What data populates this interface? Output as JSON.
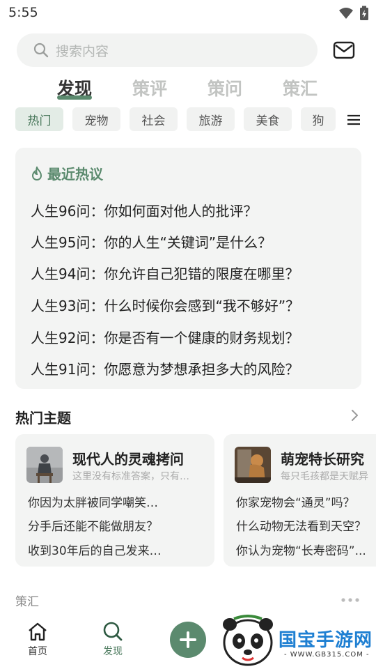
{
  "status_bar": {
    "time": "5:55"
  },
  "search": {
    "placeholder": "搜索内容"
  },
  "tabs": [
    {
      "label": "发现",
      "active": true
    },
    {
      "label": "策评",
      "active": false
    },
    {
      "label": "策问",
      "active": false
    },
    {
      "label": "策汇",
      "active": false
    }
  ],
  "chips": [
    {
      "label": "热门",
      "active": true
    },
    {
      "label": "宠物",
      "active": false
    },
    {
      "label": "社会",
      "active": false
    },
    {
      "label": "旅游",
      "active": false
    },
    {
      "label": "美食",
      "active": false
    },
    {
      "label": "狗",
      "active": false
    }
  ],
  "hot": {
    "title": "最近热议",
    "items": [
      "人生96问：你如何面对他人的批评？",
      "人生95问：你的人生“关键词”是什么？",
      "人生94问：你允许自己犯错的限度在哪里？",
      "人生93问：什么时候你会感到“我不够好”？",
      "人生92问：你是否有一个健康的财务规划？",
      "人生91问：你愿意为梦想承担多大的风险？"
    ]
  },
  "topics_section": {
    "title": "热门主题"
  },
  "topics": [
    {
      "name": "现代人的灵魂拷问",
      "desc": "这里没有标准答案，只有…",
      "questions": [
        "你因为太胖被同学嘲笑…",
        "分手后还能不能做朋友？",
        "收到30年后的自己发来…"
      ]
    },
    {
      "name": "萌宠特长研究",
      "desc": "每只毛孩都是天赋异",
      "questions": [
        "你家宠物会“通灵”吗？",
        "什么动物无法看到天空？",
        "你认为宠物“长寿密码”..."
      ]
    }
  ],
  "next_section": {
    "title": "策汇"
  },
  "bottom_nav": {
    "home_label": "首页",
    "discover_label": "发现"
  },
  "watermark": {
    "text": "国宝手游网",
    "url": "- WWW.GB315.COM -"
  },
  "colors": {
    "accent": "#5b8a6e",
    "card_bg": "#f3f4f3",
    "watermark_blue": "#1e7fd2"
  },
  "icons": [
    "search-icon",
    "mail-icon",
    "menu-icon",
    "fire-icon",
    "chevron-right-icon",
    "more-icon",
    "home-icon",
    "discover-icon",
    "add-icon",
    "wifi-icon",
    "battery-icon"
  ]
}
